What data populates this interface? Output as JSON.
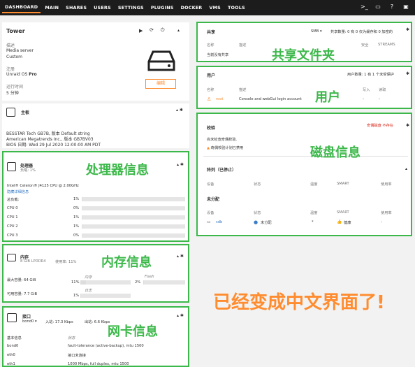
{
  "nav": {
    "items": [
      "DASHBOARD",
      "MAIN",
      "SHARES",
      "USERS",
      "SETTINGS",
      "PLUGINS",
      "DOCKER",
      "VMS",
      "TOOLS"
    ],
    "active_index": 0,
    "icons": [
      "terminal-icon",
      "chat-icon",
      "help-icon",
      "monitor-icon"
    ]
  },
  "server": {
    "name": "Tower",
    "desc_label": "描述",
    "desc_line1": "Media server",
    "desc_line2": "Custom",
    "reg_label": "注册",
    "reg_value": "Unraid OS ",
    "reg_edition": "Pro",
    "uptime_label": "运行时间",
    "uptime_value": "5 分钟",
    "edit_button": "编辑"
  },
  "motherboard": {
    "title": "主板",
    "line1": "BESSTAR Tech GB7B, 版本 Default string",
    "line2": "American Megatrends Inc., 版本 GB7BV03",
    "line3": "BIOS 日期: Wed 29 Jul 2020 12:00:00 AM PDT"
  },
  "cpu": {
    "title": "处理器",
    "load_label": "负载: 1%",
    "model": "Intel® Celeron® J4125 CPU @ 2.00GHz",
    "hide_details": "隐藏详细信息",
    "rows": [
      {
        "label": "总负载:",
        "value": "1%",
        "fill": 0.01
      },
      {
        "label": "CPU 0",
        "value": "0%",
        "fill": 0
      },
      {
        "label": "CPU 1",
        "value": "1%",
        "fill": 0.01
      },
      {
        "label": "CPU 2",
        "value": "1%",
        "fill": 0.01
      },
      {
        "label": "CPU 3",
        "value": "0%",
        "fill": 0
      }
    ]
  },
  "memory": {
    "title": "内存",
    "sub": "8 GiB LPDDR4",
    "usage": "使用率: 11%",
    "max_label": "最大容量: 64 GiB",
    "usable_label": "可用容量: 7.7 GiB",
    "ram_label": "内存",
    "ram_value": "11%",
    "flash_label": "Flash",
    "flash_value": "2%",
    "log_label": "日志",
    "log_value": "1%"
  },
  "network": {
    "title": "接口",
    "iface": "bond0",
    "in_label": "入站: 17.3 Kbps",
    "out_label": "出站: 6.6 Kbps",
    "basic_label": "基本信息",
    "status_label": "状态",
    "rows": [
      {
        "name": "bond0",
        "status": "fault-tolerance (active-backup), mtu 1500"
      },
      {
        "name": "eth0",
        "status": "接口未连接"
      },
      {
        "name": "eth1",
        "status": "1000 Mbps, full duplex, mtu 1500"
      }
    ]
  },
  "shares": {
    "title": "共享",
    "type": "SMB",
    "count_text": "共享数量: 0 有 0 仅为缓存和 0 加密的",
    "col_name": "名称",
    "col_desc": "描述",
    "col_security": "安全",
    "col_streams": "STREAMS",
    "empty": "当前没有共享"
  },
  "users": {
    "title": "用户",
    "count_text": "用户数量: 1 有 1 个未受保护",
    "col_name": "名称",
    "col_desc": "描述",
    "col_write": "写入",
    "col_read": "读取",
    "row_name": "root",
    "row_desc": "Console and webGui login account",
    "row_write": "-",
    "row_read": "-"
  },
  "disks": {
    "title": "校验",
    "status_red": "奇偶磁盘  不存在",
    "check_line1": "尚未检查奇偶校验.",
    "check_line2": "奇偶校验计划已禁用",
    "array_title": "阵列（已停止）",
    "col_device": "设备",
    "col_status": "状态",
    "col_temp": "温度",
    "col_smart": "SMART",
    "col_usage": "使用率",
    "unassigned_title": "未分配",
    "row_device": "sdb",
    "row_status": "未分配",
    "row_temp": "*",
    "row_smart": "健康",
    "row_usage": "-"
  },
  "annotations": {
    "shares": "共享文件夹",
    "users": "用户",
    "disks": "磁盘信息",
    "cpu": "处理器信息",
    "memory": "内存信息",
    "network": "网卡信息",
    "big": "已经变成中文界面了!"
  },
  "colors": {
    "accent": "#ff8c2f",
    "highlight": "#3cb84a",
    "topbar": "#1c1c1c"
  }
}
